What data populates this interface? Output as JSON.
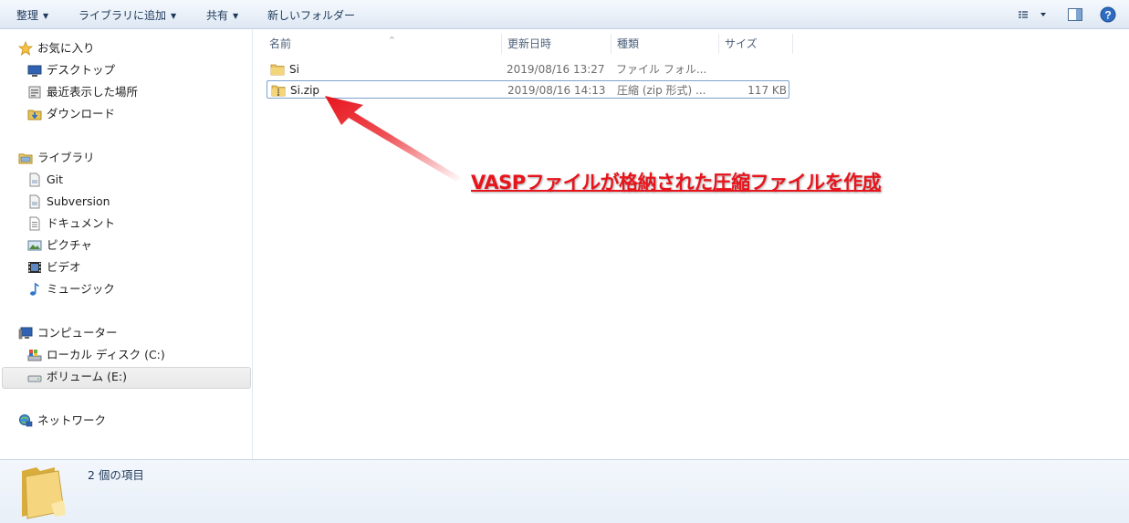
{
  "toolbar": {
    "organize": "整理",
    "include_in_library": "ライブラリに追加",
    "share_with": "共有",
    "new_folder": "新しいフォルダー",
    "view_icon": "view-options-icon",
    "preview_icon": "preview-pane-icon",
    "help_icon": "help-icon"
  },
  "nav": {
    "favorites": {
      "label": "お気に入り",
      "icon": "star-icon",
      "items": [
        {
          "label": "デスクトップ",
          "icon": "desktop-icon"
        },
        {
          "label": "最近表示した場所",
          "icon": "recent-places-icon"
        },
        {
          "label": "ダウンロード",
          "icon": "downloads-icon"
        }
      ]
    },
    "libraries": {
      "label": "ライブラリ",
      "icon": "library-icon",
      "items": [
        {
          "label": "Git",
          "icon": "library-item-icon"
        },
        {
          "label": "Subversion",
          "icon": "library-item-icon"
        },
        {
          "label": "ドキュメント",
          "icon": "documents-icon"
        },
        {
          "label": "ピクチャ",
          "icon": "pictures-icon"
        },
        {
          "label": "ビデオ",
          "icon": "videos-icon"
        },
        {
          "label": "ミュージック",
          "icon": "music-icon"
        }
      ]
    },
    "computer": {
      "label": "コンピューター",
      "icon": "computer-icon",
      "items": [
        {
          "label": "ローカル ディスク (C:)",
          "icon": "local-disk-icon"
        },
        {
          "label": "ボリューム (E:)",
          "icon": "removable-drive-icon",
          "selected": true
        }
      ]
    },
    "network": {
      "label": "ネットワーク",
      "icon": "network-icon"
    }
  },
  "columns": {
    "name": "名前",
    "date": "更新日時",
    "type": "種類",
    "size": "サイズ"
  },
  "files": [
    {
      "name": "Si",
      "date": "2019/08/16 13:27",
      "type": "ファイル フォル...",
      "size": "",
      "icon": "folder-icon"
    },
    {
      "name": "Si.zip",
      "date": "2019/08/16 14:13",
      "type": "圧縮 (zip 形式) ...",
      "size": "117 KB",
      "icon": "zip-folder-icon",
      "selected": true
    }
  ],
  "annotation": {
    "text": "VASPファイルが格納された圧縮ファイルを作成",
    "color": "#e8141c"
  },
  "details": {
    "item_count": "2 個の項目",
    "icon": "folder-large-icon"
  }
}
